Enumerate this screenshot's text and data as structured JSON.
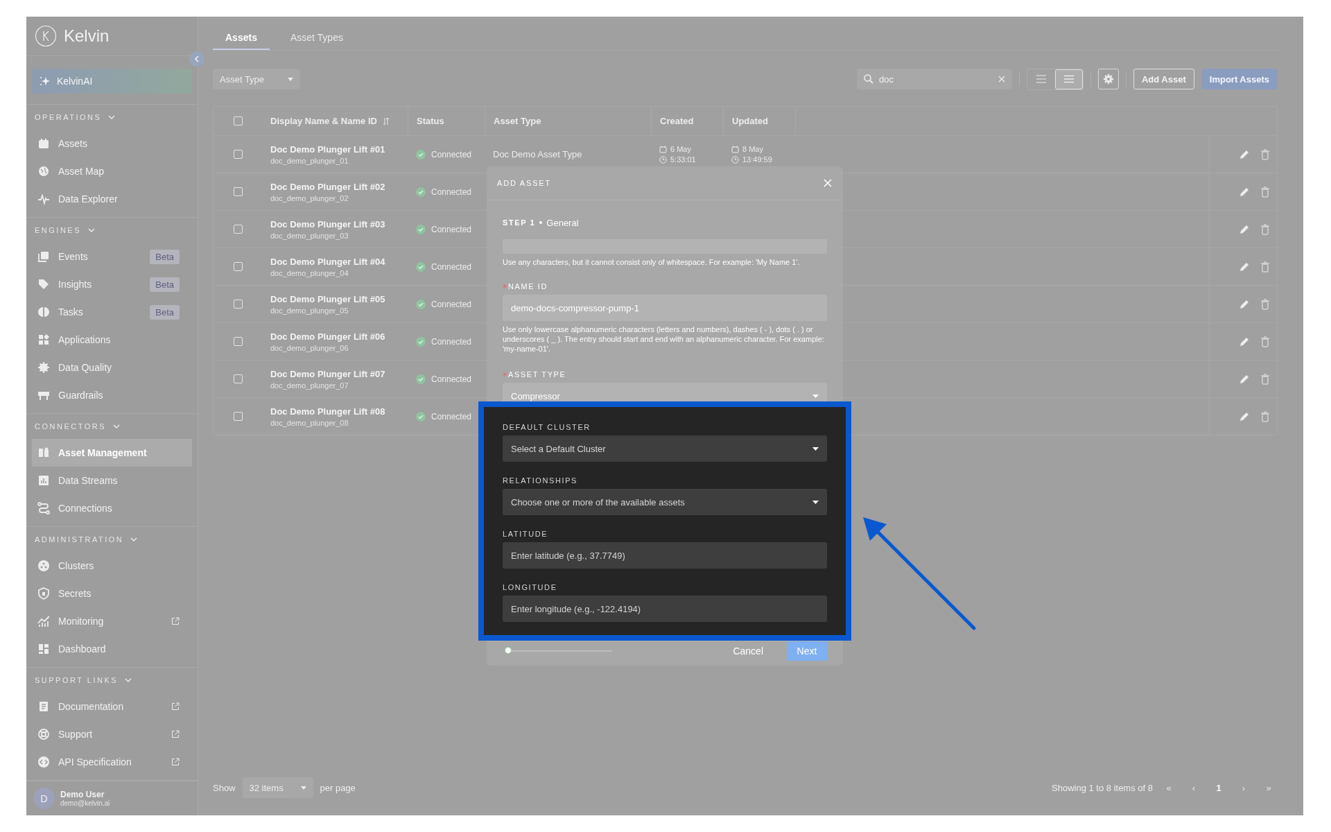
{
  "sidebar": {
    "logo": "Kelvin",
    "ai_button": "KelvinAI",
    "sections": [
      {
        "title": "OPERATIONS",
        "expanded": true,
        "items": [
          {
            "label": "Assets",
            "selected": false,
            "external": false
          },
          {
            "label": "Asset Map",
            "selected": false,
            "external": false
          },
          {
            "label": "Data Explorer",
            "selected": false,
            "external": false
          }
        ]
      },
      {
        "title": "ENGINES",
        "expanded": true,
        "items": [
          {
            "label": "Events",
            "badge": "Beta",
            "selected": false,
            "external": false
          },
          {
            "label": "Insights",
            "badge": "Beta",
            "selected": false,
            "external": false
          },
          {
            "label": "Tasks",
            "badge": "Beta",
            "selected": false,
            "external": false
          },
          {
            "label": "Applications",
            "selected": false,
            "external": false
          },
          {
            "label": "Data Quality",
            "selected": false,
            "external": false
          },
          {
            "label": "Guardrails",
            "selected": false,
            "external": false
          }
        ]
      },
      {
        "title": "CONNECTORS",
        "expanded": true,
        "items": [
          {
            "label": "Asset Management",
            "selected": true,
            "external": false
          },
          {
            "label": "Data Streams",
            "selected": false,
            "external": false
          },
          {
            "label": "Connections",
            "selected": false,
            "external": false
          }
        ]
      },
      {
        "title": "ADMINISTRATION",
        "expanded": true,
        "items": [
          {
            "label": "Clusters",
            "selected": false,
            "external": false
          },
          {
            "label": "Secrets",
            "selected": false,
            "external": false
          },
          {
            "label": "Monitoring",
            "selected": false,
            "external": true
          },
          {
            "label": "Dashboard",
            "selected": false,
            "external": false
          }
        ]
      },
      {
        "title": "SUPPORT LINKS",
        "expanded": true,
        "items": [
          {
            "label": "Documentation",
            "selected": false,
            "external": true
          },
          {
            "label": "Support",
            "selected": false,
            "external": true
          },
          {
            "label": "API Specification",
            "selected": false,
            "external": true
          }
        ]
      }
    ],
    "user": {
      "initial": "D",
      "name": "Demo User",
      "email": "demo@kelvin.ai"
    }
  },
  "main": {
    "tabs": [
      {
        "label": "Assets",
        "selected": true
      },
      {
        "label": "Asset Types",
        "selected": false
      }
    ],
    "filter": {
      "placeholder": "Asset Type"
    },
    "search": {
      "value": "doc"
    },
    "view_modes": [
      {
        "selected": false
      },
      {
        "selected": true
      }
    ],
    "actions": [
      {
        "label": "Add Asset",
        "kind": "secondary"
      },
      {
        "label": "Import Assets",
        "kind": "primary"
      }
    ],
    "table": {
      "all_checked": false,
      "columns": [
        "Display Name & Name ID",
        "Status",
        "Asset Type",
        "Created",
        "Updated"
      ],
      "rows": [
        {
          "checked": false,
          "name": "Doc Demo Plunger Lift #01",
          "name_id": "doc_demo_plunger_01",
          "status": "Connected",
          "asset_type": "Doc Demo Asset Type",
          "created": {
            "date": "6 May",
            "time": "5:33:01"
          },
          "updated": {
            "date": "8 May",
            "time": "13:49:59"
          }
        },
        {
          "checked": false,
          "name": "Doc Demo Plunger Lift #02",
          "name_id": "doc_demo_plunger_02",
          "status": "Connected"
        },
        {
          "checked": false,
          "name": "Doc Demo Plunger Lift #03",
          "name_id": "doc_demo_plunger_03",
          "status": "Connected"
        },
        {
          "checked": false,
          "name": "Doc Demo Plunger Lift #04",
          "name_id": "doc_demo_plunger_04",
          "status": "Connected"
        },
        {
          "checked": false,
          "name": "Doc Demo Plunger Lift #05",
          "name_id": "doc_demo_plunger_05",
          "status": "Connected"
        },
        {
          "checked": false,
          "name": "Doc Demo Plunger Lift #06",
          "name_id": "doc_demo_plunger_06",
          "status": "Connected"
        },
        {
          "checked": false,
          "name": "Doc Demo Plunger Lift #07",
          "name_id": "doc_demo_plunger_07",
          "status": "Connected"
        },
        {
          "checked": false,
          "name": "Doc Demo Plunger Lift #08",
          "name_id": "doc_demo_plunger_08",
          "status": "Connected"
        }
      ]
    },
    "footer": {
      "show_label": "Show",
      "page_size": "32 items",
      "per_page_label": "per page",
      "summary": "Showing 1 to 8 items of 8",
      "pages": [
        {
          "label": "«",
          "selected": false
        },
        {
          "label": "‹",
          "selected": false
        },
        {
          "label": "1",
          "selected": true
        },
        {
          "label": "›",
          "selected": false
        },
        {
          "label": "»",
          "selected": false
        }
      ]
    }
  },
  "modal": {
    "title": "ADD ASSET",
    "step": "STEP 1",
    "step_name": "General",
    "fields": [
      {
        "kind": "partial",
        "help": "Use any characters, but it cannot consist only of whitespace. For example: 'My Name 1'."
      },
      {
        "kind": "text",
        "label": "NAME ID",
        "required": true,
        "value": "demo-docs-compressor-pump-1",
        "help": "Use only lowercase alphanumeric characters (letters and numbers), dashes ( - ), dots ( . ) or underscores ( _ ). The entry should start and end with an alphanumeric character. For example: 'my-name-01'."
      },
      {
        "kind": "select",
        "label": "ASSET TYPE",
        "required": true,
        "value": "Compressor"
      }
    ],
    "highlighted_fields": [
      {
        "kind": "select",
        "label": "DEFAULT CLUSTER",
        "required": false,
        "placeholder": "Select a Default Cluster"
      },
      {
        "kind": "select",
        "label": "RELATIONSHIPS",
        "required": false,
        "placeholder": "Choose one or more of the available assets"
      },
      {
        "kind": "text",
        "label": "LATITUDE",
        "required": false,
        "placeholder": "Enter latitude (e.g., 37.7749)"
      },
      {
        "kind": "text",
        "label": "LONGITUDE",
        "required": false,
        "placeholder": "Enter longitude (e.g., -122.4194)"
      }
    ],
    "progress": {
      "level": 0
    },
    "buttons": [
      {
        "label": "Cancel",
        "kind": "text"
      },
      {
        "label": "Next",
        "kind": "primary"
      }
    ]
  }
}
